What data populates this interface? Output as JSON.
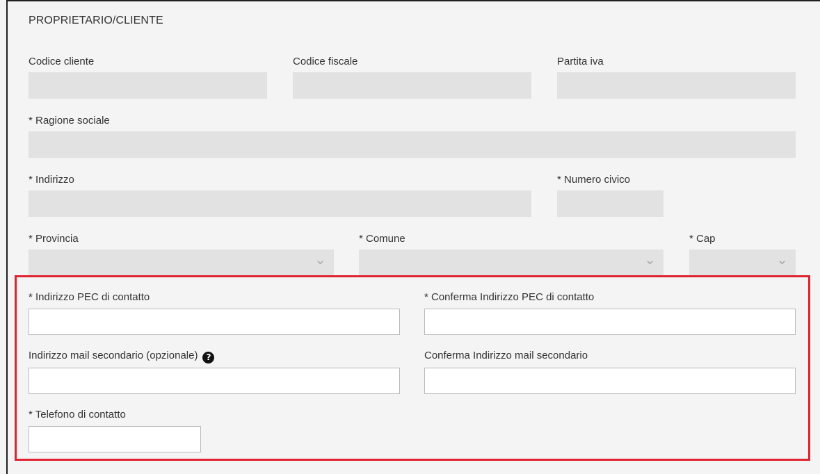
{
  "section": {
    "title": "PROPRIETARIO/CLIENTE"
  },
  "fields": {
    "codice_cliente": {
      "label": "Codice cliente",
      "value": ""
    },
    "codice_fiscale": {
      "label": "Codice fiscale",
      "value": ""
    },
    "partita_iva": {
      "label": "Partita iva",
      "value": ""
    },
    "ragione_sociale": {
      "label": "* Ragione sociale",
      "value": ""
    },
    "indirizzo": {
      "label": "* Indirizzo",
      "value": ""
    },
    "numero_civico": {
      "label": "* Numero civico",
      "value": ""
    },
    "provincia": {
      "label": "* Provincia",
      "value": ""
    },
    "comune": {
      "label": "* Comune",
      "value": ""
    },
    "cap": {
      "label": "* Cap",
      "value": ""
    },
    "pec": {
      "label": "* Indirizzo PEC di contatto",
      "value": ""
    },
    "conferma_pec": {
      "label": "* Conferma Indirizzo PEC di contatto",
      "value": ""
    },
    "mail_secondario": {
      "label": "Indirizzo mail secondario (opzionale)",
      "help_glyph": "?",
      "value": ""
    },
    "conferma_mail_secondario": {
      "label": "Conferma Indirizzo mail secondario",
      "value": ""
    },
    "telefono": {
      "label": "* Telefono di contatto",
      "value": ""
    }
  },
  "colors": {
    "highlight": "#e02330",
    "disabled_field": "#e2e2e2",
    "background": "#f4f4f4"
  },
  "icons": {
    "dropdown": "chevron-down-icon",
    "help": "question-circle-icon"
  }
}
